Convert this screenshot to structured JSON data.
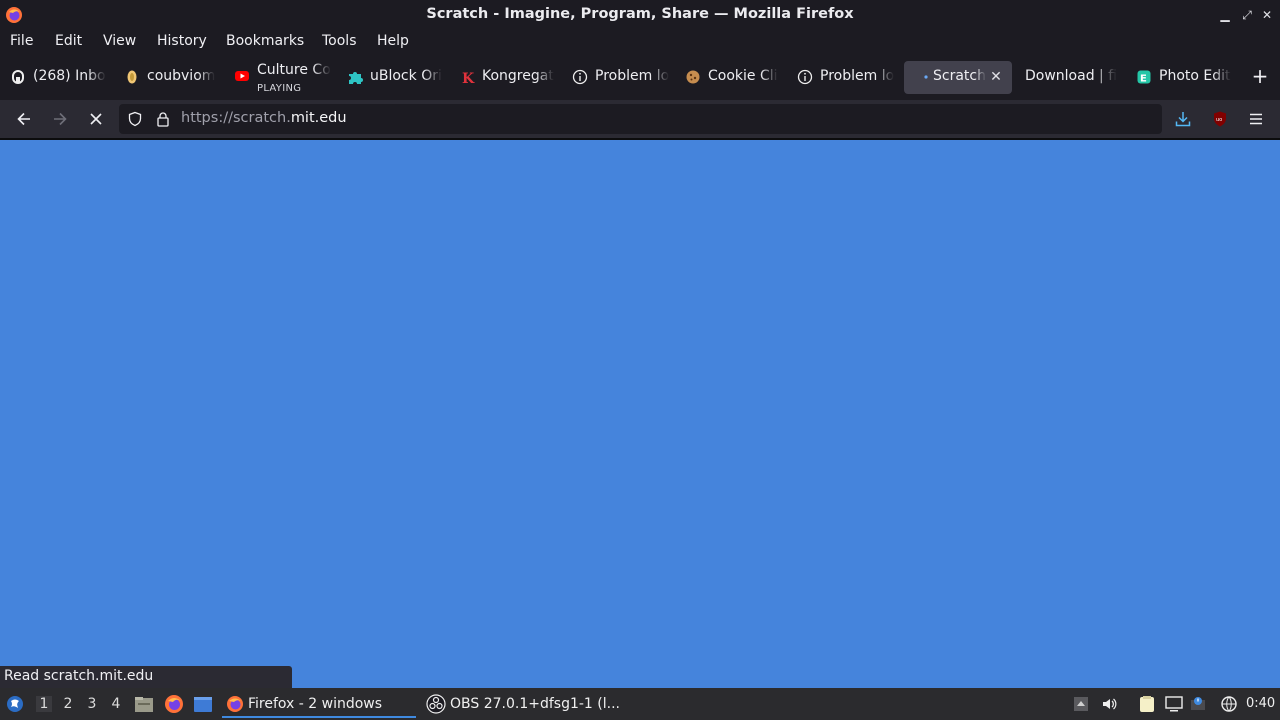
{
  "window": {
    "title": "Scratch - Imagine, Program, Share — Mozilla Firefox"
  },
  "menu": [
    "File",
    "Edit",
    "View",
    "History",
    "Bookmarks",
    "Tools",
    "Help"
  ],
  "tabs": [
    {
      "label": "(268) Inbo",
      "icon": "mail-icon"
    },
    {
      "label": "coubviom",
      "icon": "coub-icon"
    },
    {
      "label": "Culture Co",
      "sublabel": "PLAYING",
      "icon": "youtube-icon"
    },
    {
      "label": "uBlock Ori",
      "icon": "puzzle-icon"
    },
    {
      "label": "Kongregat",
      "icon": "kongregate-icon"
    },
    {
      "label": "Problem lo",
      "icon": "info-icon"
    },
    {
      "label": "Cookie Cli",
      "icon": "cookie-icon"
    },
    {
      "label": "Problem lo",
      "icon": "info-icon"
    },
    {
      "label": "Scratch",
      "icon": "loading-dot-icon",
      "active": true
    },
    {
      "label": "Download | fi",
      "icon": "none"
    },
    {
      "label": "Photo Edit",
      "icon": "photo-editor-icon"
    }
  ],
  "urlbar": {
    "url_prefix": "https://scratch.",
    "url_domain": "mit.edu"
  },
  "page": {
    "background": "#4584dc"
  },
  "status": "Read scratch.mit.edu",
  "taskbar": {
    "workspaces": [
      "1",
      "2",
      "3",
      "4"
    ],
    "tasks": [
      {
        "label": "Firefox - 2 windows",
        "icon": "firefox-icon"
      },
      {
        "label": "OBS 27.0.1+dfsg1-1 (l...",
        "icon": "obs-icon"
      }
    ],
    "clock": "0:40"
  },
  "colors": {
    "accent": "#3f8ae0",
    "download": "#54b8f5",
    "ublock": "#800000"
  }
}
